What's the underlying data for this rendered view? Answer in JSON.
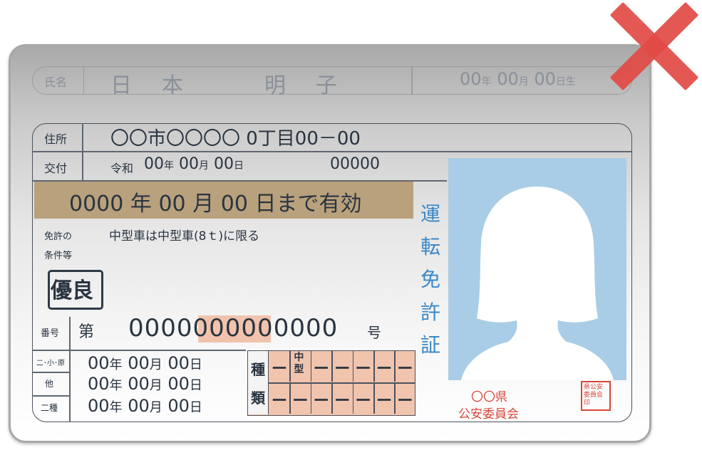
{
  "card": {
    "name_label": "氏名",
    "name_value": "日　本　　　明　子",
    "birth": {
      "y": "00",
      "y_unit": "年",
      "m": "00",
      "m_unit": "月",
      "d": "00",
      "d_unit": "日生"
    },
    "address_label": "住所",
    "address_value": "〇〇市〇〇〇〇 0丁目00－00",
    "issue_label": "交付",
    "issue_era": "令和",
    "issue_date": {
      "y": "00",
      "y_unit": "年",
      "m": "00",
      "m_unit": "月",
      "d": "00",
      "d_unit": "日"
    },
    "issue_number": "00000",
    "validity": {
      "y": "0000",
      "y_unit": "年",
      "m": "00",
      "m_unit": "月",
      "d": "00",
      "d_unit": "日まで有効"
    },
    "conditions_label_1": "免許の",
    "conditions_label_2": "条件等",
    "conditions_value": "中型車は中型車(8ｔ)に限る",
    "excellent_badge": "優良",
    "number_label": "番号",
    "number_prefix": "第",
    "number_a": "0000",
    "number_b": "00000",
    "number_c": "0000",
    "number_suffix": "号",
    "vertical_title": [
      "運",
      "転",
      "免",
      "許",
      "証"
    ],
    "row_labels": [
      "二･小･原",
      "他",
      "二種"
    ],
    "dates": [
      {
        "y": "00",
        "y_unit": "年",
        "m": "00",
        "m_unit": "月",
        "d": "00",
        "d_unit": "日"
      },
      {
        "y": "00",
        "y_unit": "年",
        "m": "00",
        "m_unit": "月",
        "d": "00",
        "d_unit": "日"
      },
      {
        "y": "00",
        "y_unit": "年",
        "m": "00",
        "m_unit": "月",
        "d": "00",
        "d_unit": "日"
      }
    ],
    "type_label_1": "種",
    "type_label_2": "類",
    "type_mid_1": "中",
    "type_mid_2": "型",
    "dash": "ー",
    "issuer_line_1": "〇〇県",
    "issuer_line_2": "公安委員会",
    "seal_text": "県公安委員会印"
  },
  "colors": {
    "accent_blue": "#3a88c8",
    "validity_band": "#b8a17c",
    "highlight": "#f1c3ad",
    "red": "#d8463a",
    "photo_bg": "#a9cde6"
  },
  "icons": [
    "portrait-silhouette",
    "red-x-mark",
    "seal-stamp"
  ]
}
